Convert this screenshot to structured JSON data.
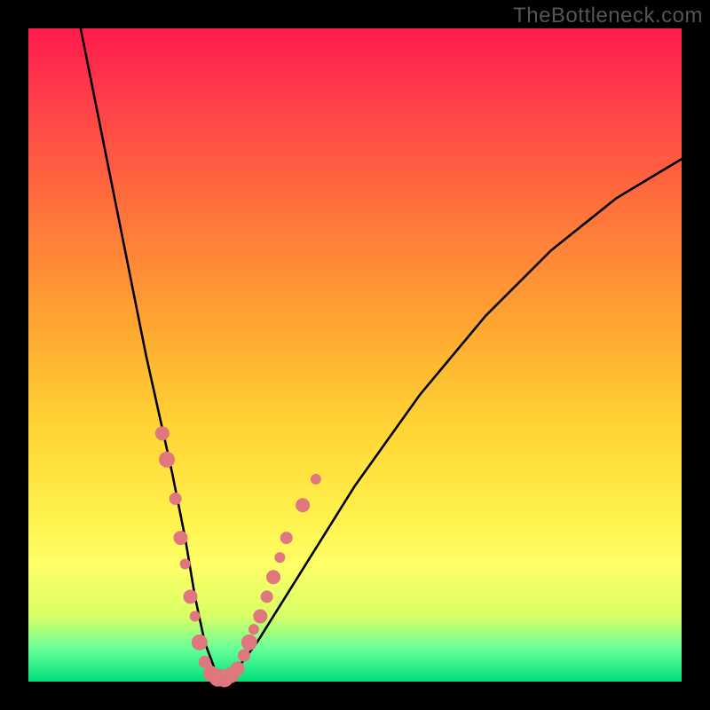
{
  "watermark": "TheBottleneck.com",
  "chart_data": {
    "type": "line",
    "title": "",
    "xlabel": "",
    "ylabel": "",
    "xlim": [
      0,
      100
    ],
    "ylim": [
      0,
      100
    ],
    "series": [
      {
        "name": "bottleneck-curve",
        "x": [
          8,
          10,
          12,
          14,
          16,
          18,
          20,
          22,
          24,
          25.5,
          27,
          28.5,
          30,
          32,
          35,
          40,
          45,
          50,
          55,
          60,
          65,
          70,
          75,
          80,
          85,
          90,
          95,
          100
        ],
        "values": [
          100,
          90,
          80,
          70,
          60,
          50,
          41,
          32,
          22,
          13,
          6,
          2,
          0.5,
          2,
          6,
          14,
          22,
          30,
          37,
          44,
          50,
          56,
          61,
          66,
          70,
          74,
          77,
          80
        ]
      }
    ],
    "markers": {
      "name": "highlight-points",
      "color": "#e0767e",
      "points": [
        {
          "x": 20.5,
          "y": 38,
          "r": 8
        },
        {
          "x": 21.2,
          "y": 34,
          "r": 9
        },
        {
          "x": 22.5,
          "y": 28,
          "r": 7
        },
        {
          "x": 23.3,
          "y": 22,
          "r": 8
        },
        {
          "x": 24.0,
          "y": 18,
          "r": 6
        },
        {
          "x": 24.8,
          "y": 13,
          "r": 8
        },
        {
          "x": 25.5,
          "y": 10,
          "r": 6
        },
        {
          "x": 26.2,
          "y": 6,
          "r": 9
        },
        {
          "x": 27.0,
          "y": 3,
          "r": 7
        },
        {
          "x": 28.0,
          "y": 1.2,
          "r": 9
        },
        {
          "x": 29.0,
          "y": 0.6,
          "r": 10
        },
        {
          "x": 30.0,
          "y": 0.5,
          "r": 10
        },
        {
          "x": 31.0,
          "y": 1,
          "r": 9
        },
        {
          "x": 32.0,
          "y": 2,
          "r": 8
        },
        {
          "x": 33.0,
          "y": 4,
          "r": 7
        },
        {
          "x": 33.8,
          "y": 6,
          "r": 9
        },
        {
          "x": 34.5,
          "y": 8,
          "r": 6
        },
        {
          "x": 35.5,
          "y": 10,
          "r": 8
        },
        {
          "x": 36.5,
          "y": 13,
          "r": 7
        },
        {
          "x": 37.5,
          "y": 16,
          "r": 8
        },
        {
          "x": 38.5,
          "y": 19,
          "r": 6
        },
        {
          "x": 39.5,
          "y": 22,
          "r": 7
        },
        {
          "x": 42.0,
          "y": 27,
          "r": 8
        },
        {
          "x": 44.0,
          "y": 31,
          "r": 6
        }
      ]
    }
  }
}
